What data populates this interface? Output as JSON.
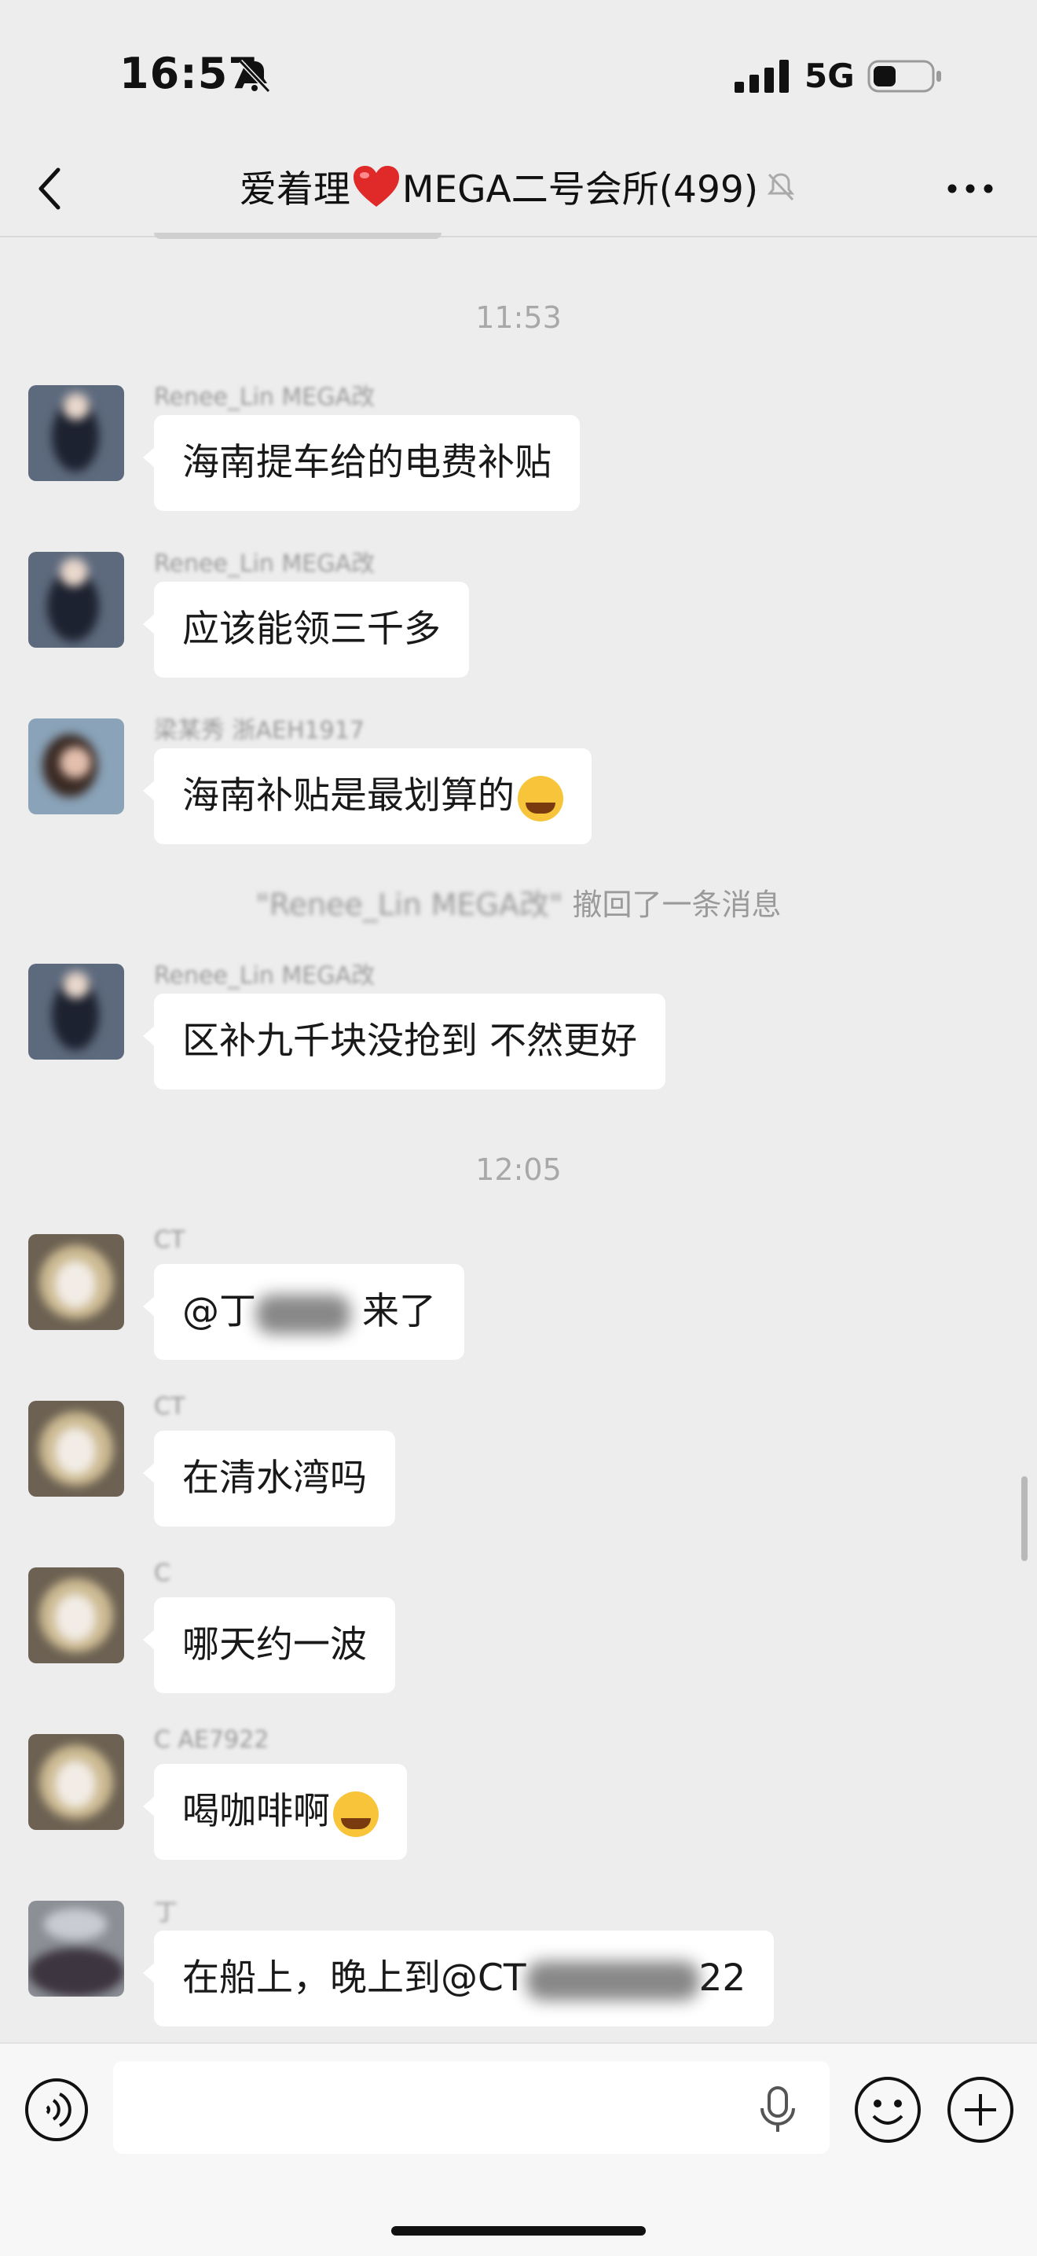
{
  "status_bar": {
    "time": "16:57",
    "network": "5G"
  },
  "header": {
    "title_prefix": "爱着理",
    "title_suffix": "MEGA二号会所(499)"
  },
  "messages_block_1": {
    "timestamp": "11:53",
    "m1": {
      "sender": "Renee_Lin MEGA改",
      "text": "海南提车给的电费补贴"
    },
    "m2": {
      "sender": "Renee_Lin MEGA改",
      "text": "应该能领三千多"
    },
    "m3": {
      "sender": "梁某秀 浙AEH1917",
      "text": "海南补贴是最划算的"
    },
    "recall": {
      "name": "\"Renee_Lin MEGA改\"",
      "text": " 撤回了一条消息"
    },
    "m4": {
      "sender": "Renee_Lin MEGA改",
      "text": "区补九千块没抢到 不然更好"
    }
  },
  "messages_block_2": {
    "timestamp": "12:05",
    "m5": {
      "sender": "CT",
      "text_a": "@丁",
      "text_b": " 来了"
    },
    "m6": {
      "sender": "CT",
      "text": "在清水湾吗"
    },
    "m7": {
      "sender": "C",
      "text": "哪天约一波"
    },
    "m8": {
      "sender": "C AE7922",
      "text": "喝咖啡啊"
    },
    "m9": {
      "sender": "丁",
      "text_a": "在船上，晚上到@CT",
      "text_b": "22"
    }
  },
  "input": {
    "placeholder": ""
  },
  "colors": {
    "accent_heart": "#e02a2a",
    "bubble": "#ffffff",
    "background": "#ededed"
  }
}
